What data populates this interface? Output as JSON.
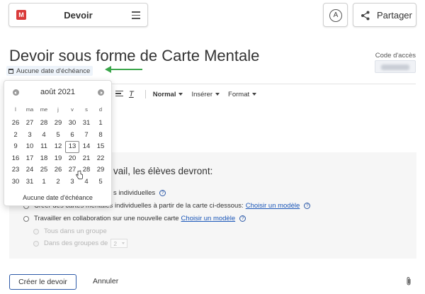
{
  "header": {
    "app_logo": "M",
    "app_title": "Devoir",
    "accessibility_label": "A",
    "share_label": "Partager"
  },
  "page": {
    "title": "Devoir sous forme de Carte Mentale",
    "due_date_label": "Aucune date d'échéance",
    "access_code_label": "Code d'accès"
  },
  "toolbar": {
    "clear_format": "T",
    "style_select": "Normal",
    "insert_select": "Insérer",
    "format_select": "Format"
  },
  "datepicker": {
    "month_label": "août 2021",
    "weekdays": [
      "l",
      "ma",
      "me",
      "j",
      "v",
      "s",
      "d"
    ],
    "weeks": [
      [
        "26",
        "27",
        "28",
        "29",
        "30",
        "31",
        "1"
      ],
      [
        "2",
        "3",
        "4",
        "5",
        "6",
        "7",
        "8"
      ],
      [
        "9",
        "10",
        "11",
        "12",
        "13",
        "14",
        "15"
      ],
      [
        "16",
        "17",
        "18",
        "19",
        "20",
        "21",
        "22"
      ],
      [
        "23",
        "24",
        "25",
        "26",
        "27",
        "28",
        "29"
      ],
      [
        "30",
        "31",
        "1",
        "2",
        "3",
        "4",
        "5"
      ]
    ],
    "today": "13",
    "hovered": "27",
    "footer": "Aucune date d'échéance"
  },
  "instructions": {
    "heading": "vail, les élèves devront:",
    "option1": "s individuelles",
    "option2": "Créer des cartes mentales individuelles à partir de la carte ci-dessous:",
    "option2_link": "Choisir un modèle",
    "option3": "Travailler en collaboration sur une nouvelle carte",
    "option3_link": "Choisir un modèle",
    "sub1": "Tous dans un groupe",
    "sub2": "Dans des groupes de",
    "group_size": "2",
    "help_glyph": "?"
  },
  "footer": {
    "create_label": "Créer le devoir",
    "cancel_label": "Annuler"
  },
  "colors": {
    "accent": "#2d5aa8",
    "arrow": "#3aa64a",
    "logo": "#d93a3a"
  }
}
